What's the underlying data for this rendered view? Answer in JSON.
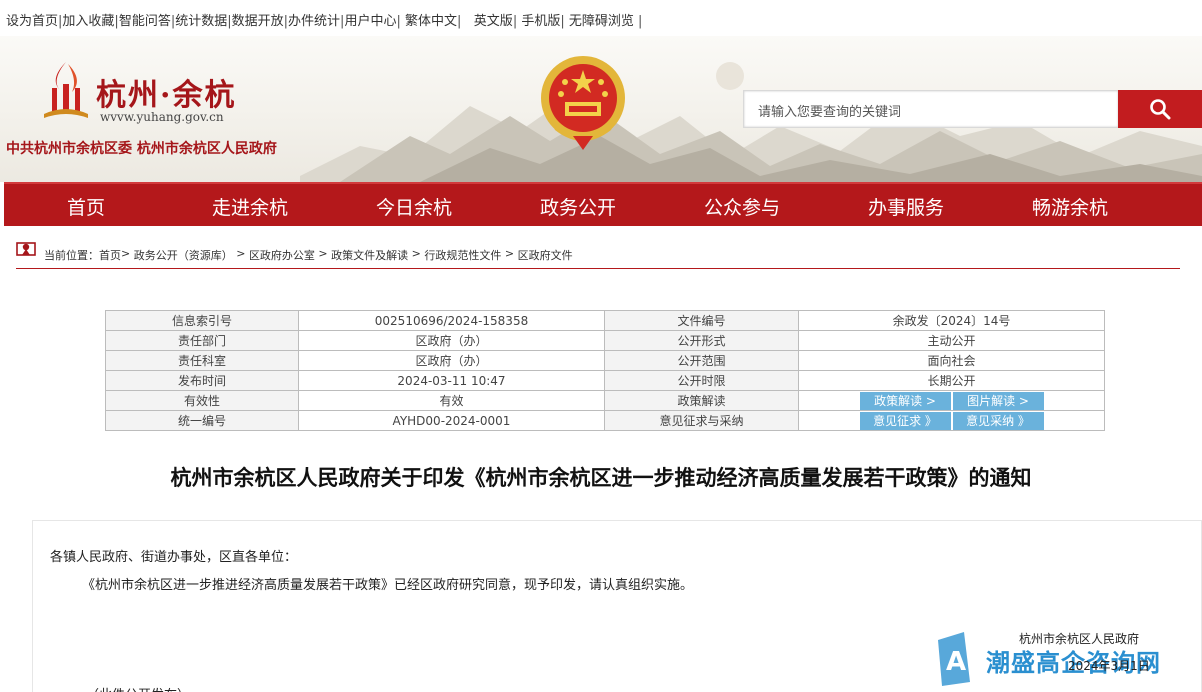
{
  "util_links": [
    "设为首页",
    "加入收藏",
    "智能问答",
    "统计数据",
    "数据开放",
    "办件统计",
    "用户中心",
    "繁体中文",
    "英文版",
    "手机版",
    "无障碍浏览"
  ],
  "header": {
    "site_name": "杭州·余杭",
    "site_url": "wvvw.yuhang.gov.cn",
    "org_line": "中共杭州市余杭区委  杭州市余杭区人民政府"
  },
  "search": {
    "placeholder": "请输入您要查询的关键词"
  },
  "nav": [
    "首页",
    "走进余杭",
    "今日余杭",
    "政务公开",
    "公众参与",
    "办事服务",
    "畅游余杭"
  ],
  "breadcrumb": {
    "label": "当前位置：",
    "items": [
      "首页",
      "政务公开（资源库）",
      "区政府办公室",
      "政策文件及解读",
      "行政规范性文件",
      "区政府文件"
    ]
  },
  "info_table": [
    {
      "k1": "信息索引号",
      "v1": "002510696/2024-158358",
      "k2": "文件编号",
      "v2": "余政发〔2024〕14号"
    },
    {
      "k1": "责任部门",
      "v1": "区政府（办）",
      "k2": "公开形式",
      "v2": "主动公开"
    },
    {
      "k1": "责任科室",
      "v1": "区政府（办）",
      "k2": "公开范围",
      "v2": "面向社会"
    },
    {
      "k1": "发布时间",
      "v1": "2024-03-11 10:47",
      "k2": "公开时限",
      "v2": "长期公开"
    },
    {
      "k1": "有效性",
      "v1": "有效",
      "k2": "政策解读"
    },
    {
      "k1": "统一编号",
      "v1": "AYHD00-2024-0001",
      "k2": "意见征求与采纳"
    }
  ],
  "tags": {
    "policy_interp": "政策解读 >",
    "image_interp": "图片解读 >",
    "opinion_collect": "意见征求 》",
    "opinion_adopt": "意见采纳 》"
  },
  "doc": {
    "title": "杭州市余杭区人民政府关于印发《杭州市余杭区进一步推动经济高质量发展若干政策》的通知",
    "addressee": "各镇人民政府、街道办事处，区直各单位：",
    "paragraph": "《杭州市余杭区进一步推进经济高质量发展若干政策》已经区政府研究同意，现予印发，请认真组织实施。",
    "signer": "杭州市余杭区人民政府",
    "date": "2024年3月1日",
    "note": "（此件公开发布）"
  },
  "watermark": {
    "text": "潮盛高企咨询网"
  },
  "colors": {
    "brand_red": "#b4181b",
    "tag_blue": "#6ab2dc",
    "watermark_blue": "#2a8fd0"
  }
}
